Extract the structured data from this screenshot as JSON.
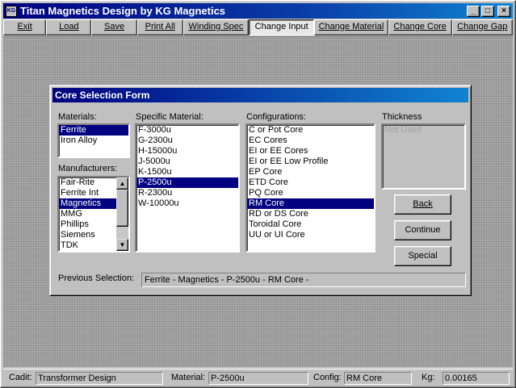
{
  "window": {
    "title": "Titan Magnetics Design by KG Magnetics",
    "icon_text": "KG",
    "controls": {
      "minimize": "_",
      "maximize": "□",
      "close": "×"
    }
  },
  "menu": {
    "exit": "Exit",
    "load": "Load",
    "save": "Save",
    "print_all": "Print All",
    "winding_spec": "Winding Spec",
    "change_input": "Change Input",
    "change_material": "Change Material",
    "change_core": "Change Core",
    "change_gap": "Change Gap"
  },
  "dialog": {
    "title": "Core Selection Form",
    "materials": {
      "label": "Materials:",
      "items": [
        "Ferrite",
        "Iron Alloy"
      ],
      "selected_index": 0
    },
    "manufacturers": {
      "label": "Manufacturers:",
      "items": [
        "Fair-Rite",
        "Ferrite Int",
        "Magnetics",
        "MMG",
        "Phillips",
        "Siemens",
        "TDK"
      ],
      "selected_index": 2
    },
    "specific_material": {
      "label": "Specific Material:",
      "items": [
        "F-3000u",
        "G-2300u",
        "H-15000u",
        "J-5000u",
        "K-1500u",
        "P-2500u",
        "R-2300u",
        "W-10000u"
      ],
      "selected_index": 5
    },
    "configurations": {
      "label": "Configurations:",
      "items": [
        "C or Pot Core",
        "EC Cores",
        "EI or EE Cores",
        "EI or EE Low Profile",
        "EP Core",
        "ETD Core",
        "PQ Core",
        "RM Core",
        "RD or DS Core",
        "Toroidal Core",
        "UU or UI Core"
      ],
      "selected_index": 7
    },
    "thickness": {
      "label": "Thickness",
      "items": [
        "Not Used"
      ]
    },
    "buttons": {
      "back": "Back",
      "continue": "Continue",
      "special": "Special"
    },
    "previous_selection": {
      "label": "Previous Selection:",
      "value": "Ferrite - Magnetics - P-2500u - RM Core -"
    }
  },
  "status": {
    "cadit_label": "Cadit:",
    "cadit_value": "Transformer Design",
    "material_label": "Material:",
    "material_value": "P-2500u",
    "config_label": "Config:",
    "config_value": "RM Core",
    "kg_label": "Kg:",
    "kg_value": "0.00165"
  }
}
